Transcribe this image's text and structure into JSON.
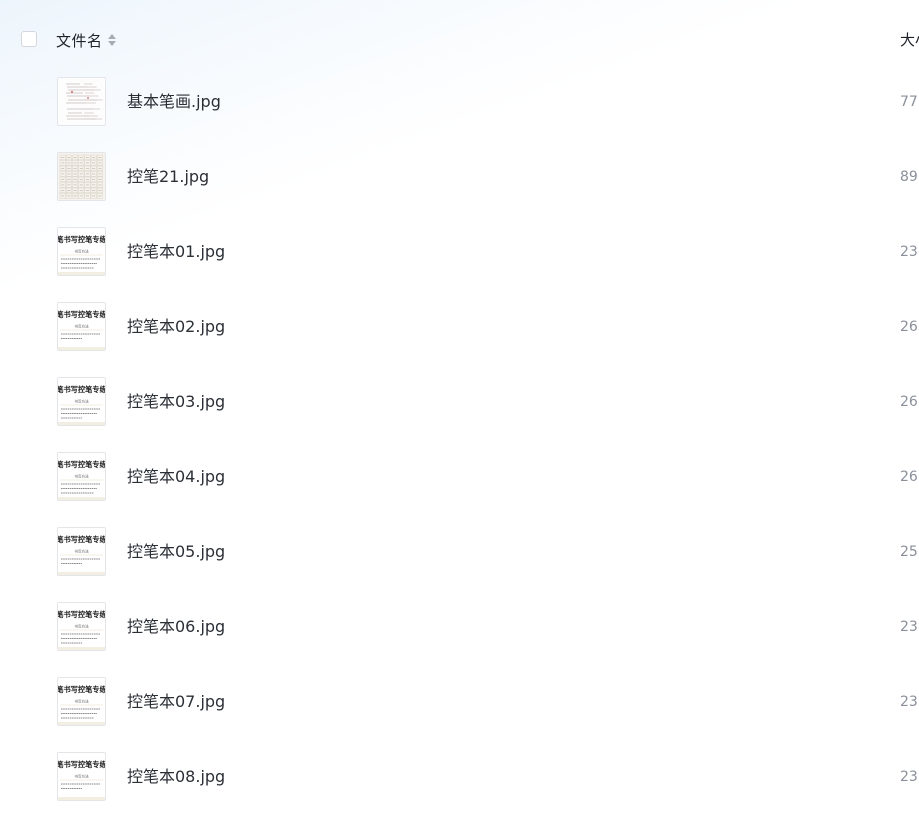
{
  "header": {
    "name_column_label": "文件名",
    "size_column_label": "大小"
  },
  "files": [
    {
      "name": "基本笔画.jpg",
      "size": "77",
      "thumb": "stroke-sheet"
    },
    {
      "name": "控笔21.jpg",
      "size": "89",
      "thumb": "grid-sheet"
    },
    {
      "name": "控笔本01.jpg",
      "size": "23",
      "thumb": "workbook-page",
      "thumb_title": "笔书写控笔专练",
      "thumb_subtitle": "书写方法"
    },
    {
      "name": "控笔本02.jpg",
      "size": "26",
      "thumb": "workbook-page",
      "thumb_title": "笔书写控笔专练",
      "thumb_subtitle": "书写方法"
    },
    {
      "name": "控笔本03.jpg",
      "size": "26",
      "thumb": "workbook-page",
      "thumb_title": "笔书写控笔专练",
      "thumb_subtitle": "书写方法"
    },
    {
      "name": "控笔本04.jpg",
      "size": "26",
      "thumb": "workbook-page",
      "thumb_title": "笔书写控笔专练",
      "thumb_subtitle": "书写方法"
    },
    {
      "name": "控笔本05.jpg",
      "size": "25",
      "thumb": "workbook-page",
      "thumb_title": "笔书写控笔专练",
      "thumb_subtitle": "书写方法"
    },
    {
      "name": "控笔本06.jpg",
      "size": "23",
      "thumb": "workbook-page",
      "thumb_title": "笔书写控笔专练",
      "thumb_subtitle": "书写方法"
    },
    {
      "name": "控笔本07.jpg",
      "size": "23",
      "thumb": "workbook-page",
      "thumb_title": "笔书写控笔专练",
      "thumb_subtitle": "书写方法"
    },
    {
      "name": "控笔本08.jpg",
      "size": "23",
      "thumb": "workbook-page",
      "thumb_title": "笔书写控笔专练",
      "thumb_subtitle": "书写方法"
    }
  ]
}
